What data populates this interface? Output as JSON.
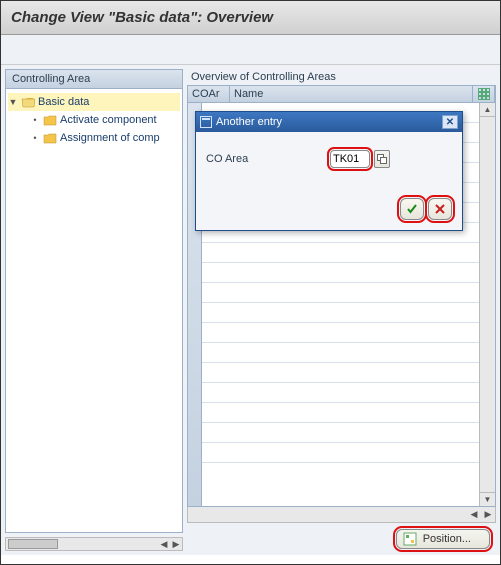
{
  "title": "Change View \"Basic data\": Overview",
  "left": {
    "header": "Controlling Area",
    "root": "Basic data",
    "children": [
      "Activate component",
      "Assignment of comp"
    ]
  },
  "right": {
    "overview_label": "Overview of Controlling Areas",
    "cols": {
      "coa": "COAr",
      "name": "Name"
    }
  },
  "modal": {
    "title": "Another entry",
    "field_label": "CO Area",
    "field_value": "TK01"
  },
  "position_label": "Position...",
  "icons": {
    "folder_open": "folder-open-icon",
    "folder": "folder-icon",
    "table_cfg": "table-settings-icon",
    "modal": "window-icon",
    "close": "close-icon",
    "f4": "value-help-icon",
    "ok": "ok-icon",
    "cancel": "cancel-icon",
    "position": "position-icon"
  }
}
